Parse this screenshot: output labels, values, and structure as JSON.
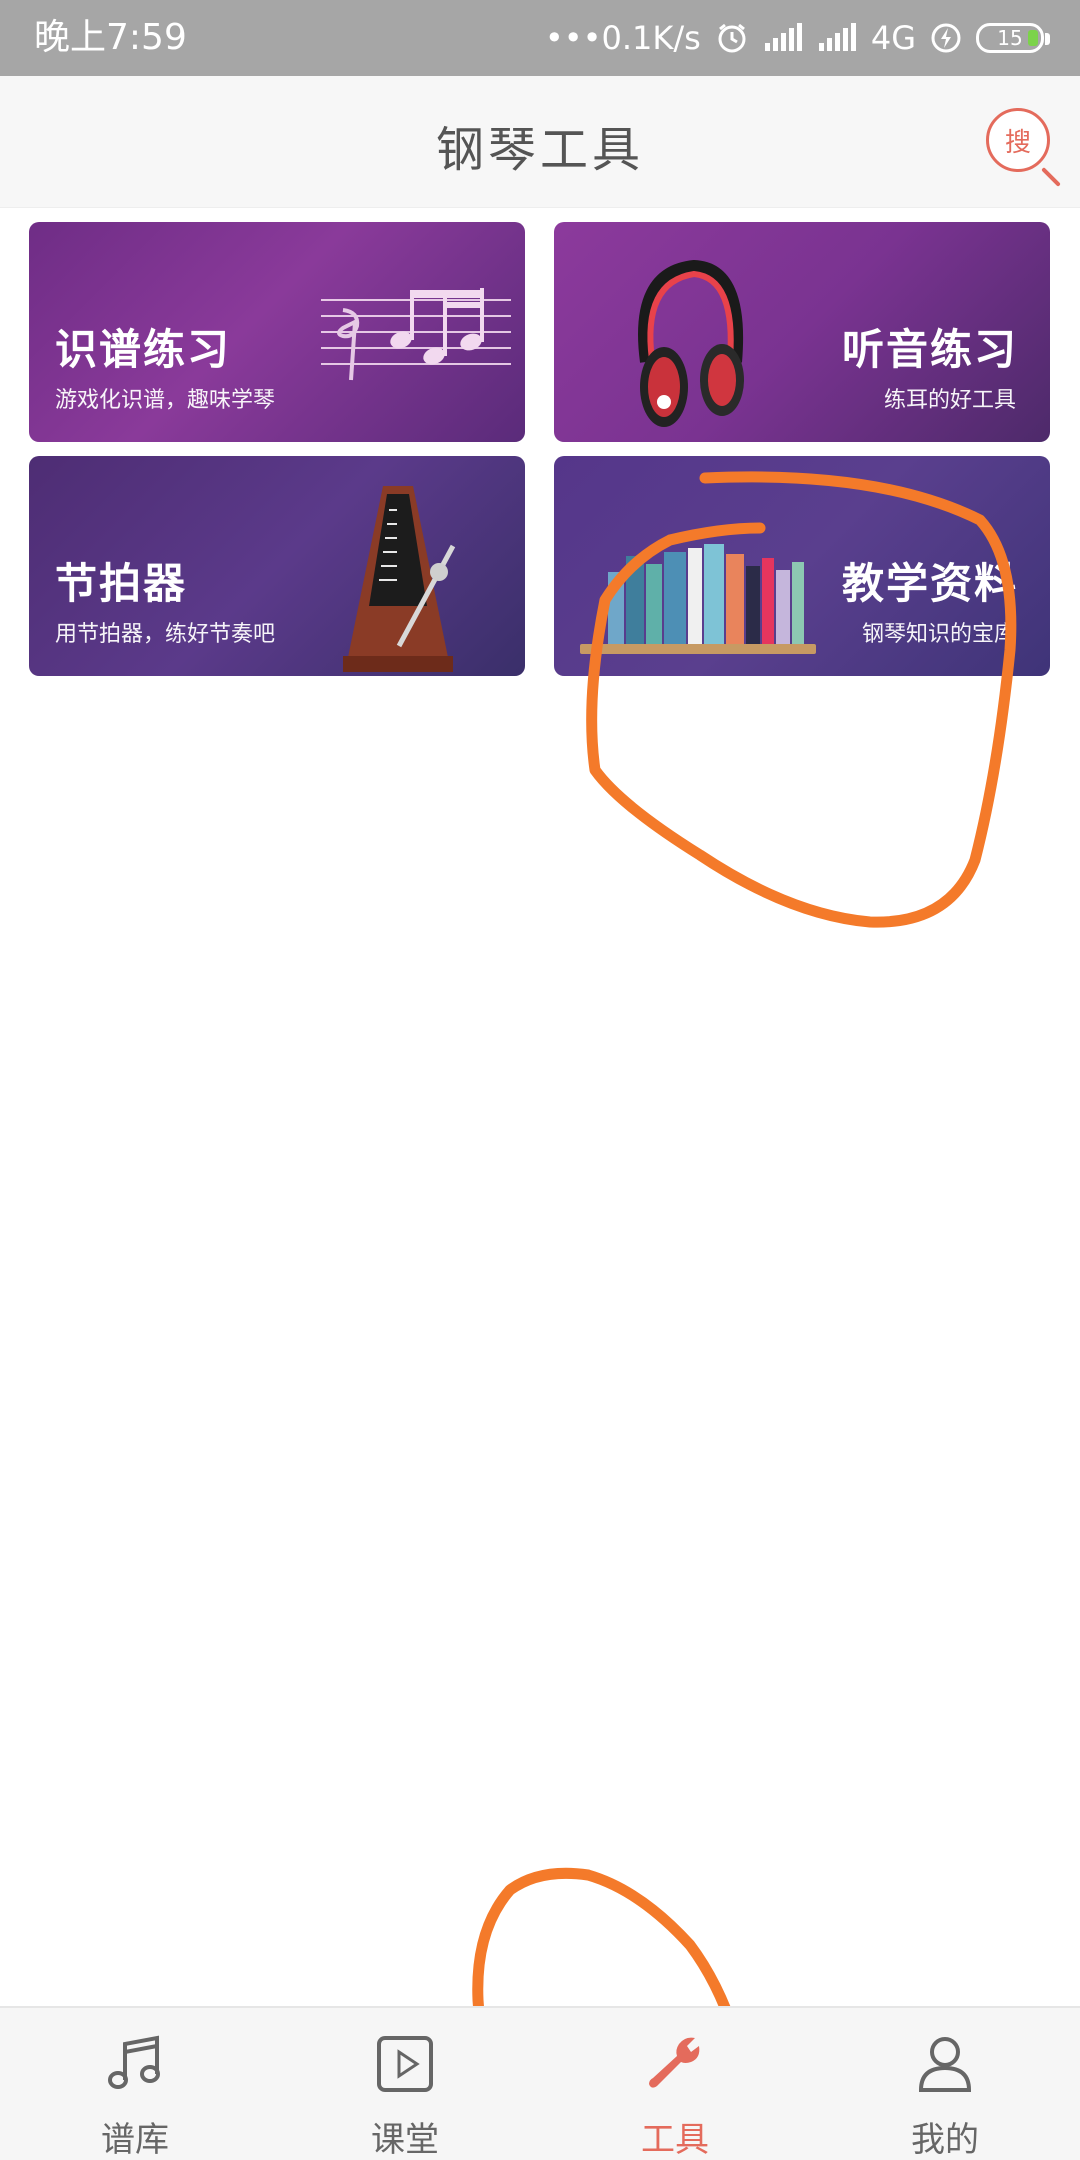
{
  "status": {
    "time": "晚上7:59",
    "network_speed": "•••0.1K/s",
    "network_type": "4G",
    "battery": "15"
  },
  "header": {
    "title": "钢琴工具",
    "search_label": "搜"
  },
  "cards": [
    {
      "title": "识谱练习",
      "subtitle": "游戏化识谱，趣味学琴"
    },
    {
      "title": "听音练习",
      "subtitle": "练耳的好工具"
    },
    {
      "title": "节拍器",
      "subtitle": "用节拍器，练好节奏吧"
    },
    {
      "title": "教学资料",
      "subtitle": "钢琴知识的宝库"
    }
  ],
  "nav": [
    {
      "label": "谱库",
      "icon": "music-note-icon"
    },
    {
      "label": "课堂",
      "icon": "play-icon"
    },
    {
      "label": "工具",
      "icon": "wrench-icon",
      "active": true
    },
    {
      "label": "我的",
      "icon": "user-icon"
    }
  ],
  "colors": {
    "accent": "#e46b5c",
    "annotation": "#f47a2a",
    "statusbar": "#a6a6a6"
  }
}
